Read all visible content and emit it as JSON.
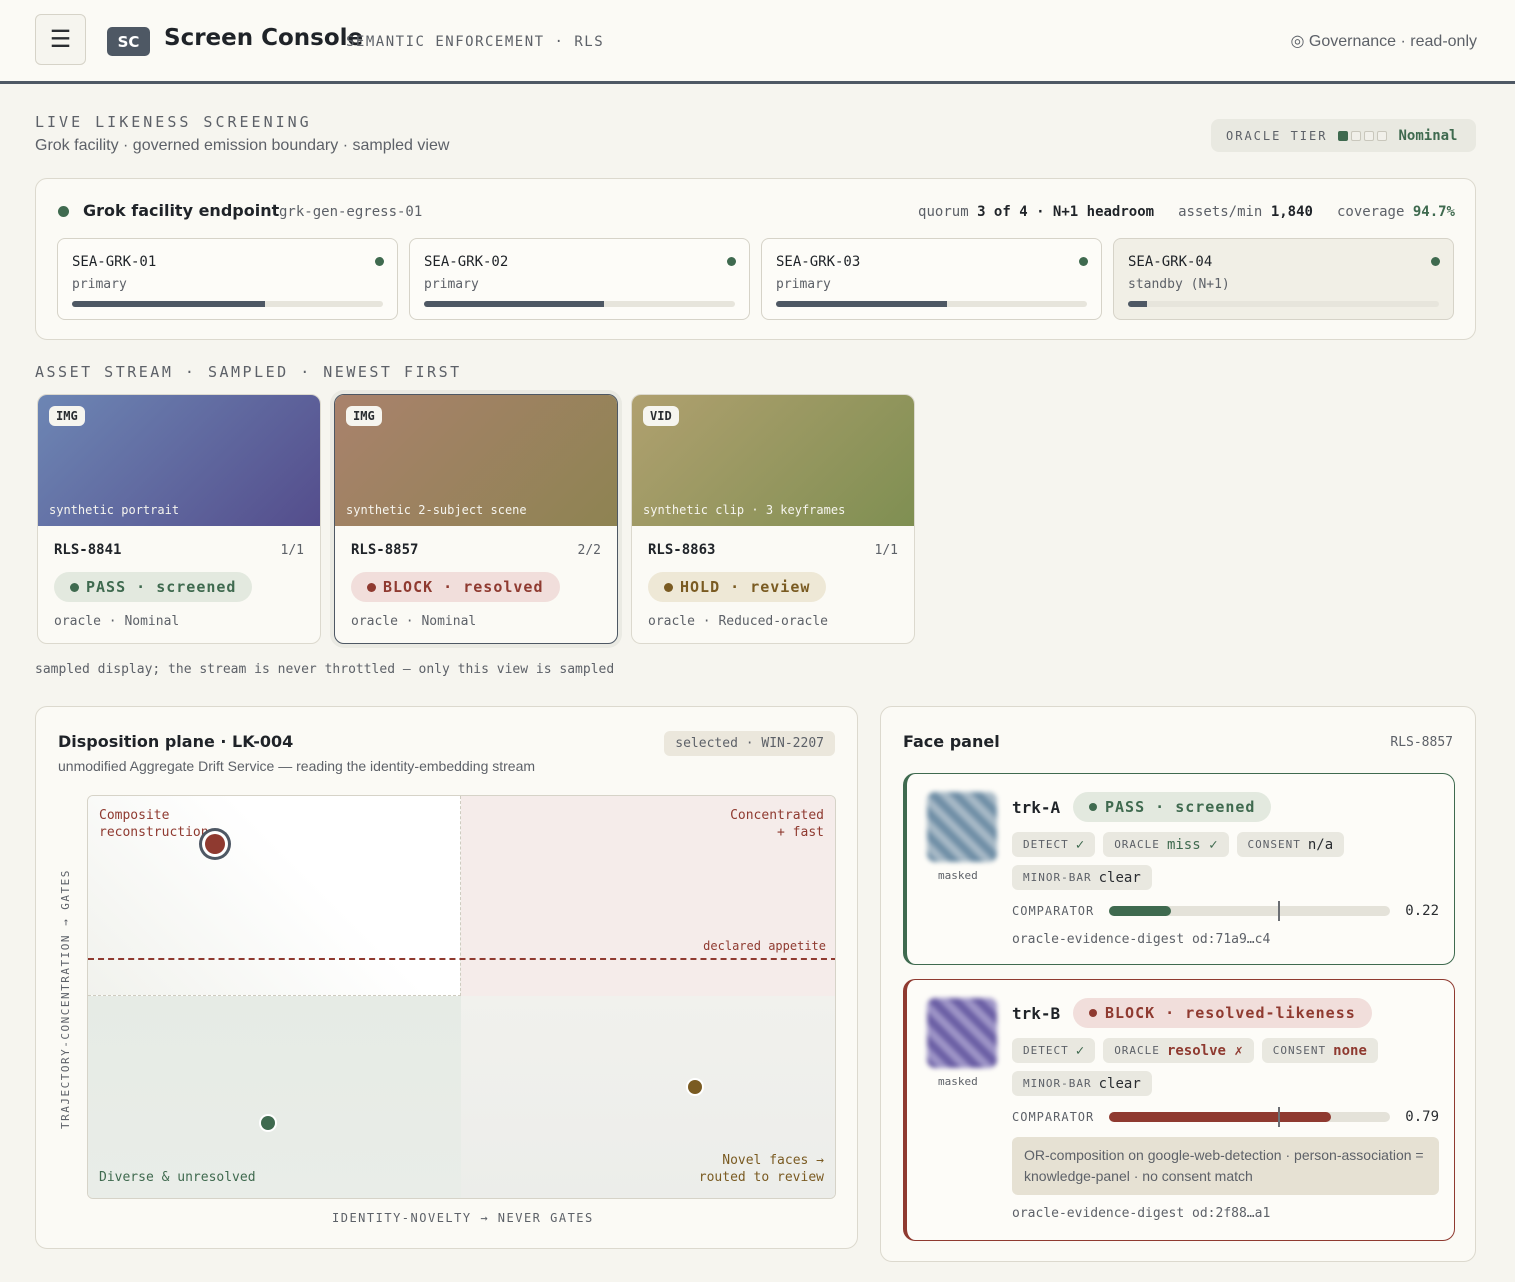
{
  "header": {
    "menu_icon": "☰",
    "logo": "SC",
    "title": "Screen Console",
    "subtitle": "SEMANTIC ENFORCEMENT · RLS",
    "governance_icon": "◎",
    "governance": "Governance · read-only"
  },
  "screening": {
    "heading": "LIVE LIKENESS SCREENING",
    "subheading": "Grok facility · governed emission boundary · sampled view",
    "oracle_tier_label": "ORACLE TIER",
    "oracle_tier_level": 1,
    "oracle_tier_levels": 4,
    "oracle_tier_value": "Nominal"
  },
  "endpoint": {
    "title": "Grok facility endpoint",
    "id": "grk-gen-egress-01",
    "quorum_label": "quorum",
    "quorum_value": "3 of 4 · N+1 headroom",
    "rate_label": "assets/min",
    "rate_value": "1,840",
    "coverage_label": "coverage",
    "coverage_value": "94.7%",
    "nodes": [
      {
        "name": "SEA-GRK-01",
        "role": "primary",
        "load": 0.62
      },
      {
        "name": "SEA-GRK-02",
        "role": "primary",
        "load": 0.58
      },
      {
        "name": "SEA-GRK-03",
        "role": "primary",
        "load": 0.55
      },
      {
        "name": "SEA-GRK-04",
        "role": "standby (N+1)",
        "load": 0.06
      }
    ]
  },
  "stream": {
    "heading": "ASSET STREAM · SAMPLED · NEWEST FIRST",
    "note": "sampled display; the stream is never throttled — only this view is sampled",
    "assets": [
      {
        "kind": "IMG",
        "caption": "synthetic portrait",
        "id": "RLS-8841",
        "count": "1/1",
        "status": "PASS · screened",
        "oracle": "oracle · Nominal"
      },
      {
        "kind": "IMG",
        "caption": "synthetic 2-subject scene",
        "id": "RLS-8857",
        "count": "2/2",
        "status": "BLOCK · resolved",
        "oracle": "oracle · Nominal"
      },
      {
        "kind": "VID",
        "caption": "synthetic clip · 3 keyframes",
        "id": "RLS-8863",
        "count": "1/1",
        "status": "HOLD · review",
        "oracle": "oracle · Reduced-oracle"
      }
    ]
  },
  "disposition": {
    "title": "Disposition plane · LK-004",
    "subtitle": "unmodified Aggregate Drift Service — reading the identity-embedding stream",
    "selected": "selected · WIN-2207",
    "quadrants": {
      "top_left": "Composite\nreconstruction",
      "top_right": "Concentrated\n+ fast",
      "bottom_left": "Diverse & unresolved",
      "bottom_right": "Novel faces →\nrouted to review"
    },
    "appetite_label": "declared appetite",
    "y_axis": "TRAJECTORY-CONCENTRATION → GATES",
    "x_axis": "IDENTITY-NOVELTY → NEVER GATES"
  },
  "chart_data": {
    "type": "scatter",
    "xlabel": "IDENTITY-NOVELTY → NEVER GATES",
    "ylabel": "TRAJECTORY-CONCENTRATION → GATES",
    "xlim": [
      0,
      1
    ],
    "ylim": [
      0,
      1
    ],
    "threshold_y": 0.6,
    "points": [
      {
        "x": 0.17,
        "y": 0.88,
        "color": "#8f3a30",
        "selected": true
      },
      {
        "x": 0.24,
        "y": 0.19,
        "color": "#3f6a4f",
        "selected": false
      },
      {
        "x": 0.81,
        "y": 0.28,
        "color": "#7a5b22",
        "selected": false
      }
    ]
  },
  "face_panel": {
    "title": "Face panel",
    "record": "RLS-8857",
    "tracks": [
      {
        "name": "trk-A",
        "status": "PASS · screened",
        "masked": "masked",
        "chips": [
          {
            "k": "DETECT",
            "v": "✓"
          },
          {
            "k": "ORACLE",
            "v": "miss ✓"
          },
          {
            "k": "CONSENT",
            "v": "n/a"
          },
          {
            "k": "MINOR-BAR",
            "v": "clear"
          }
        ],
        "comparator_label": "COMPARATOR",
        "comparator": 0.22,
        "comparator_text": "0.22",
        "threshold": 0.6,
        "digest": "oracle-evidence-digest od:71a9…c4"
      },
      {
        "name": "trk-B",
        "status": "BLOCK · resolved-likeness",
        "masked": "masked",
        "chips": [
          {
            "k": "DETECT",
            "v": "✓"
          },
          {
            "k": "ORACLE",
            "v": "resolve ✗"
          },
          {
            "k": "CONSENT",
            "v": "none"
          },
          {
            "k": "MINOR-BAR",
            "v": "clear"
          }
        ],
        "comparator_label": "COMPARATOR",
        "comparator": 0.79,
        "comparator_text": "0.79",
        "threshold": 0.6,
        "note": "OR-composition on google-web-detection · person-association = knowledge-panel · no consent match",
        "digest": "oracle-evidence-digest od:2f88…a1"
      }
    ]
  },
  "colors": {
    "pass": "#3f6a4f",
    "block": "#8f3a30",
    "hold": "#7a5b22",
    "slate": "#4e5864"
  }
}
